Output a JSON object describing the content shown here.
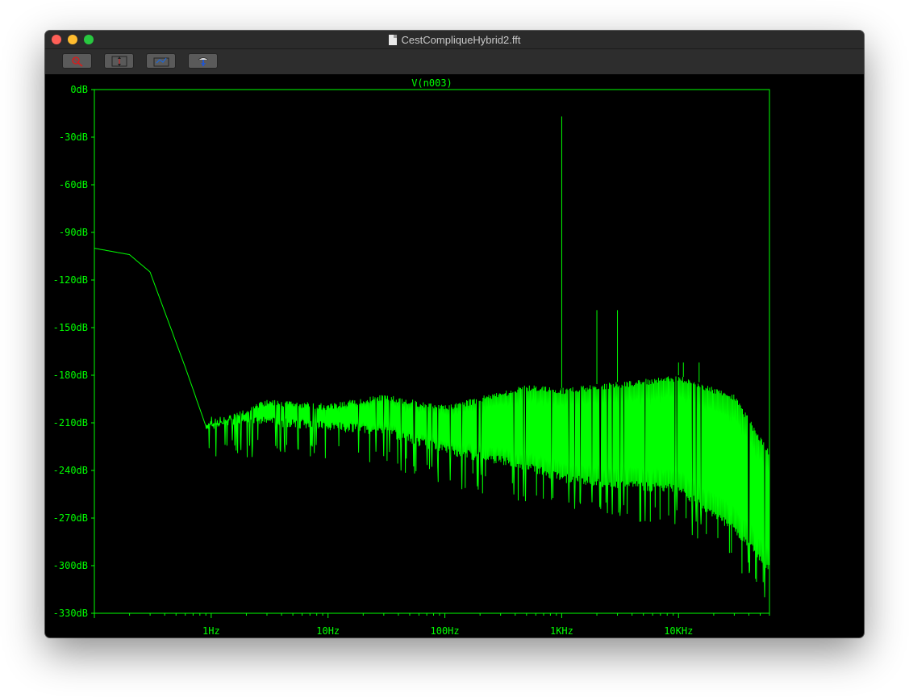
{
  "window": {
    "title": "CestCompliqueHybrid2.fft"
  },
  "toolbar": {
    "buttons": [
      {
        "name": "zoom-tool",
        "icon": "zoom-cancel-icon"
      },
      {
        "name": "autorange-tool",
        "icon": "autorange-icon"
      },
      {
        "name": "fit-tool",
        "icon": "fit-icon"
      },
      {
        "name": "probe-tool",
        "icon": "probe-icon"
      }
    ]
  },
  "chart_data": {
    "type": "line",
    "title": "V(n003)",
    "xlabel": "",
    "ylabel": "",
    "x_scale": "log",
    "xlim_hz": [
      0.1,
      60000
    ],
    "ylim_db": [
      -330,
      0
    ],
    "y_ticks": [
      "0dB",
      "-30dB",
      "-60dB",
      "-90dB",
      "-120dB",
      "-150dB",
      "-180dB",
      "-210dB",
      "-240dB",
      "-270dB",
      "-300dB",
      "-330dB"
    ],
    "x_ticks": [
      "1Hz",
      "10Hz",
      "100Hz",
      "1KHz",
      "10KHz"
    ],
    "colors": {
      "trace": "#00ff00",
      "background": "#000000",
      "axes": "#00ff00"
    },
    "series": [
      {
        "name": "V(n003)",
        "envelope_points": [
          {
            "x": 0.1,
            "top": -100,
            "bottom": -100
          },
          {
            "x": 0.2,
            "top": -104,
            "bottom": -104
          },
          {
            "x": 0.3,
            "top": -115,
            "bottom": -115
          },
          {
            "x": 0.4,
            "top": -140,
            "bottom": -140
          },
          {
            "x": 0.6,
            "top": -175,
            "bottom": -175
          },
          {
            "x": 0.9,
            "top": -212,
            "bottom": -212
          },
          {
            "x": 3,
            "top": -195,
            "bottom": -212
          },
          {
            "x": 10,
            "top": -198,
            "bottom": -215
          },
          {
            "x": 30,
            "top": -192,
            "bottom": -218
          },
          {
            "x": 100,
            "top": -199,
            "bottom": -230
          },
          {
            "x": 500,
            "top": -186,
            "bottom": -240
          },
          {
            "x": 1000,
            "top": -188,
            "bottom": -248
          },
          {
            "x": 10000,
            "top": -180,
            "bottom": -255
          },
          {
            "x": 30000,
            "top": -192,
            "bottom": -280
          },
          {
            "x": 60000,
            "top": -228,
            "bottom": -305
          }
        ],
        "peaks": [
          {
            "x": 1000,
            "y": -17
          },
          {
            "x": 2000,
            "y": -139
          },
          {
            "x": 3000,
            "y": -139
          },
          {
            "x": 10000,
            "y": -172
          },
          {
            "x": 11000,
            "y": -172
          },
          {
            "x": 15000,
            "y": -172
          }
        ]
      }
    ]
  }
}
